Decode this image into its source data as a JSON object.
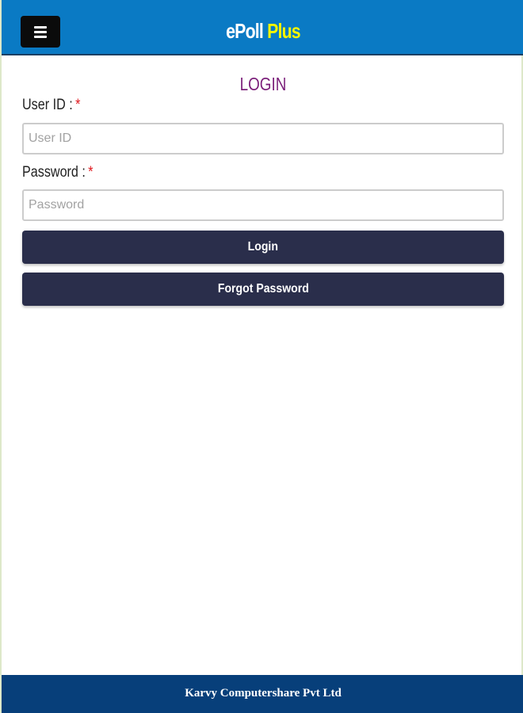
{
  "header": {
    "menu_icon": "hamburger-menu-icon",
    "brand_prefix": "ePoll",
    "brand_suffix": "Plus",
    "brand_suffix_color": "#f4f400",
    "background_color": "#0a7ac4"
  },
  "login": {
    "title": "LOGIN",
    "user_id": {
      "label": "User ID :",
      "required_mark": "*",
      "value": "",
      "placeholder": "User ID"
    },
    "password": {
      "label": "Password :",
      "required_mark": "*",
      "value": "",
      "placeholder": "Password"
    },
    "login_button_label": "Login",
    "forgot_button_label": "Forgot Password",
    "button_color": "#2a2e4b"
  },
  "footer": {
    "text": "Karvy Computershare Pvt Ltd",
    "background_color": "#073f7a"
  }
}
